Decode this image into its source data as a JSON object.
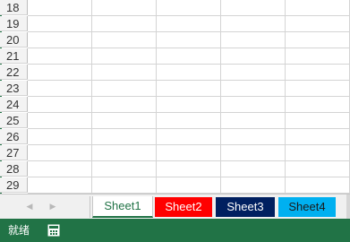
{
  "grid": {
    "row_numbers": [
      "18",
      "19",
      "20",
      "21",
      "22",
      "23",
      "24",
      "25",
      "26",
      "27",
      "28",
      "29"
    ]
  },
  "tabbar": {
    "nav_prev": "◀",
    "nav_next": "▶",
    "tabs": [
      {
        "label": "Sheet1",
        "active": true,
        "bg": "#ffffff",
        "fg": "#217346"
      },
      {
        "label": "Sheet2",
        "active": false,
        "bg": "#ff0000",
        "fg": "#ffffff"
      },
      {
        "label": "Sheet3",
        "active": false,
        "bg": "#002060",
        "fg": "#ffffff"
      },
      {
        "label": "Sheet4",
        "active": false,
        "bg": "#00b0f0",
        "fg": "#1a1a1a"
      }
    ]
  },
  "statusbar": {
    "status": "就绪",
    "macro_icon": "macro-record-icon",
    "color": "#217346"
  }
}
